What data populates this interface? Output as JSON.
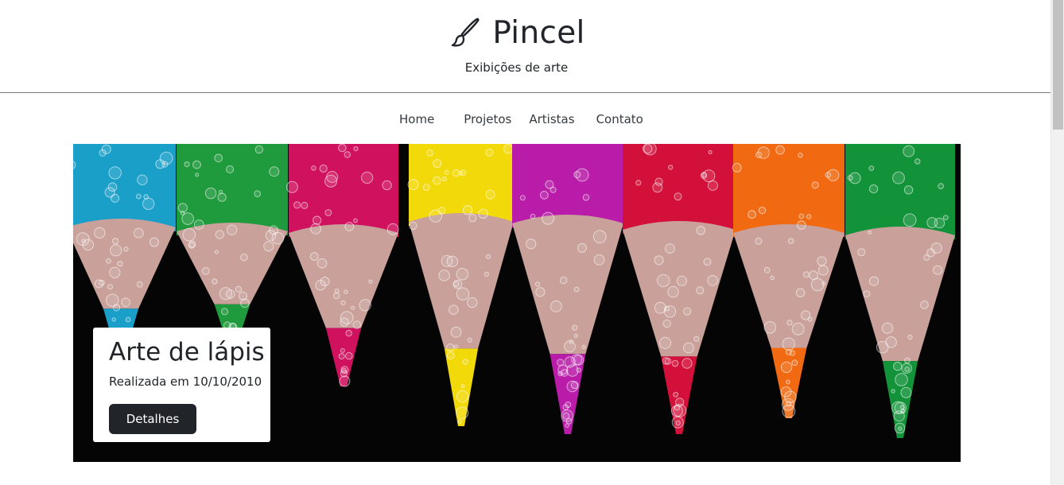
{
  "header": {
    "brand_icon": "paintbrush-icon",
    "title": "Pincel",
    "tagline": "Exibições de arte"
  },
  "nav": {
    "items": [
      {
        "label": "Home"
      },
      {
        "label": "Projetos"
      },
      {
        "label": "Artistas"
      },
      {
        "label": "Contato"
      }
    ]
  },
  "hero": {
    "image_subject": "colored pencils with bubbles",
    "pencil_colors": [
      "#1a9fc9",
      "#1f9a3c",
      "#d0125e",
      "#f2d90a",
      "#b81ca8",
      "#d3103a",
      "#f16a12",
      "#139339"
    ],
    "caption": {
      "title": "Arte de lápis",
      "date_text": "Realizada em 10/10/2010",
      "button_label": "Detalhes"
    }
  },
  "colors": {
    "text": "#212529",
    "button_bg": "#212529",
    "button_text": "#ffffff",
    "divider": "#7a7a7a"
  }
}
